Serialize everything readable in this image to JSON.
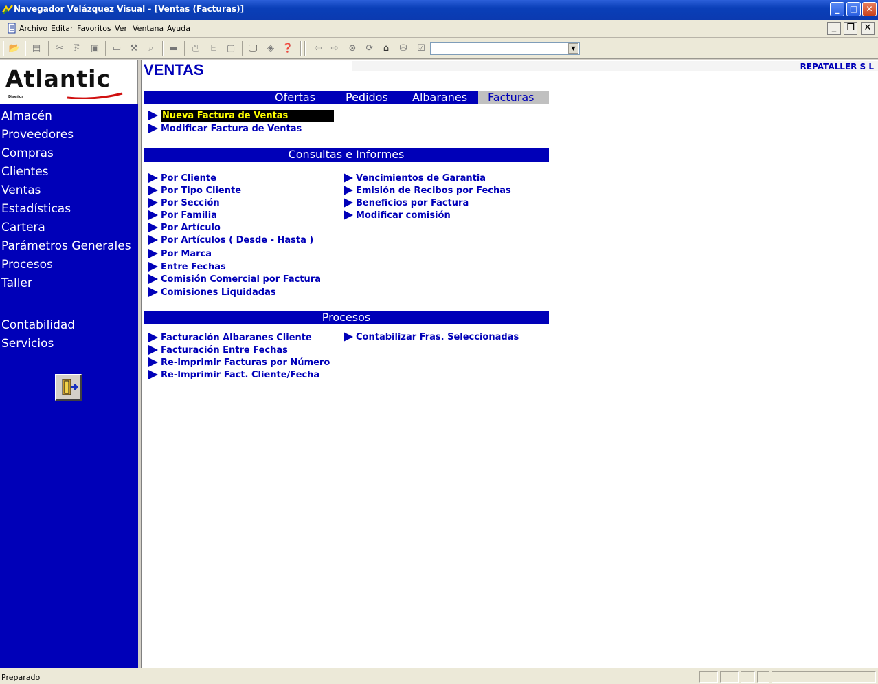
{
  "window": {
    "title": "Navegador Velázquez Visual - [Ventas (Facturas)]",
    "min": "_",
    "max": "□",
    "close": "✕"
  },
  "menu": [
    "Archivo",
    "Editar",
    "Favoritos",
    "Ver",
    "Ventana",
    "Ayuda"
  ],
  "mdi": {
    "min": "_",
    "restore": "❐",
    "close": "✕"
  },
  "combo_value": "",
  "logo": {
    "text": "Atlantic",
    "sub": "Diseños"
  },
  "nav": {
    "items": [
      "Almacén",
      "Proveedores",
      "Compras",
      "Clientes",
      "Ventas",
      "Estadísticas",
      "Cartera",
      "Parámetros Generales",
      "Procesos",
      "Taller"
    ],
    "extra": [
      "Contabilidad",
      "Servicios"
    ]
  },
  "main": {
    "title": "VENTAS",
    "company": "REPATALLER S L",
    "tabs": [
      "Ofertas",
      "Pedidos",
      "Albaranes",
      "Facturas"
    ],
    "active_tab": "Facturas",
    "facturas_links": [
      "Nueva Factura de Ventas",
      "Modificar Factura de Ventas"
    ],
    "consultas": {
      "title": "Consultas e Informes",
      "left": [
        "Por Cliente",
        "Por Tipo Cliente",
        "Por Sección",
        "Por Familia",
        "Por Artículo",
        "Por Artículos ( Desde - Hasta )",
        "Por Marca",
        "Entre Fechas",
        "Comisión Comercial por Factura",
        "Comisiones Liquidadas"
      ],
      "right": [
        "Vencimientos de Garantia",
        "Emisión de Recibos por Fechas",
        "Beneficios por Factura",
        "Modificar comisión"
      ]
    },
    "procesos": {
      "title": "Procesos",
      "left": [
        "Facturación Albaranes Cliente",
        "Facturación Entre Fechas",
        "Re-Imprimir Facturas por Número",
        "Re-Imprimir Fact. Cliente/Fecha"
      ],
      "right": [
        "Contabilizar Fras. Seleccionadas"
      ]
    }
  },
  "status": {
    "text": "Preparado"
  },
  "colors": {
    "nav_bg": "#0000b8",
    "link": "#0000b8",
    "selected_bg": "#000000",
    "selected_text": "#ffff00",
    "title_bar": "#0a3fb8"
  }
}
